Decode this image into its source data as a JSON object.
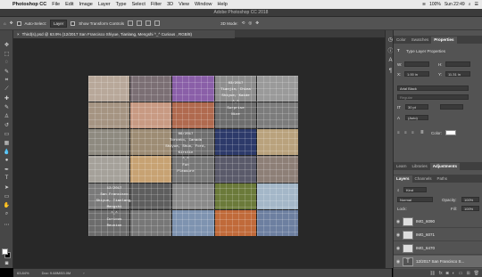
{
  "menubar": {
    "app_name": "Photoshop CC",
    "items": [
      "File",
      "Edit",
      "Image",
      "Layer",
      "Type",
      "Select",
      "Filter",
      "3D",
      "View",
      "Window",
      "Help"
    ],
    "status": "100%",
    "clock": "Sun 22:49"
  },
  "window": {
    "title": "Adobe Photoshop CC 2018"
  },
  "options": {
    "auto_select_label": "Auto-Select:",
    "auto_select_value": "Layer",
    "transform_label": "Show Transform Controls",
    "mode_3d": "3D Mode:"
  },
  "document": {
    "tab_title": "Third(s).psd @ 63.9% (12/2017  San Francisco  Shiyue, Tianlang, Mengshi  ^_^ Curious , RGB/8)"
  },
  "artwork": {
    "text_tiles": [
      {
        "lines": [
          "03/2017",
          "Tianjin, China",
          "Shiyue, Kaide",
          "^_^",
          "Surprise",
          "Nice"
        ]
      },
      {
        "lines": [
          "06/2017",
          "Toronto, Canada",
          "Shiyue, Shuo, Ford, Kirstin",
          "^_^",
          "Fun",
          "Pleasure"
        ]
      },
      {
        "lines": [
          "12/2017",
          "San Francisco",
          "Shiyue, Tianlang, Mengshi",
          "^_^",
          "Curious",
          "Reunion"
        ]
      }
    ]
  },
  "status": {
    "zoom": "63.84%",
    "doc": "Doc: 9.68M/53.0M"
  },
  "properties_panel": {
    "tabs": [
      "Color",
      "Swatches",
      "Properties"
    ],
    "active_tab": "Properties",
    "title": "Type Layer Properties",
    "w_label": "W:",
    "h_label": "H:",
    "x_label": "X:",
    "x_value": "1.00 in",
    "y_label": "Y:",
    "y_value": "11.31 in",
    "font_family": "Arial Black",
    "font_style": "Regular",
    "font_size": "30 pt",
    "leading": "(Auto)",
    "color_label": "Color:",
    "text_color": "#ffffff"
  },
  "lower_tabs": [
    "Learn",
    "Libraries",
    "Adjustments"
  ],
  "layers_panel": {
    "tabs": [
      "Layers",
      "Channels",
      "Paths"
    ],
    "active_tab": "Layers",
    "filter": "Kind",
    "blend_mode": "Normal",
    "opacity_label": "Opacity:",
    "opacity": "100%",
    "lock_label": "Lock:",
    "fill_label": "Fill:",
    "fill": "100%",
    "layers": [
      {
        "name": "IMG_6090",
        "type": "image"
      },
      {
        "name": "IMG_6071",
        "type": "image"
      },
      {
        "name": "IMG_6470",
        "type": "image"
      },
      {
        "name": "12/2017  San Francisco  S...",
        "type": "text"
      }
    ]
  },
  "colors": {
    "ui_dark": "#535353",
    "canvas_bg": "#282828",
    "accent": "#ffffff"
  }
}
